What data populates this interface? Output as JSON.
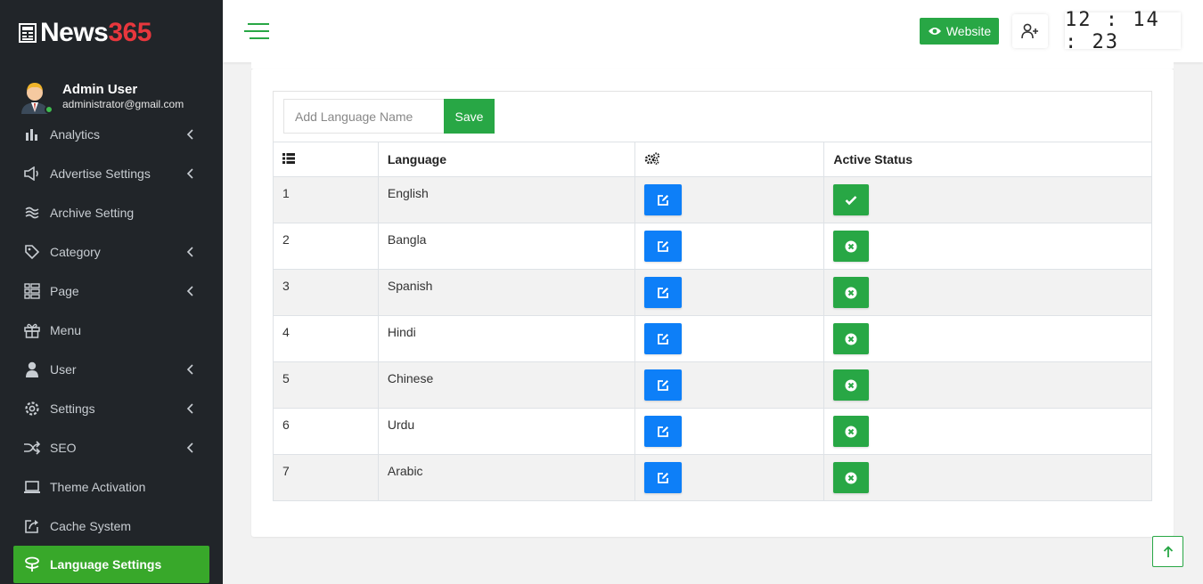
{
  "brand": {
    "name_part1": "News",
    "name_part2": "365"
  },
  "user": {
    "name": "Admin User",
    "email": "administrator@gmail.com"
  },
  "sidebar": {
    "items": [
      {
        "label": "Analytics",
        "icon": "bar-chart-icon",
        "has_submenu": true
      },
      {
        "label": "Advertise Settings",
        "icon": "megaphone-icon",
        "has_submenu": true
      },
      {
        "label": "Archive Setting",
        "icon": "archive-waves-icon",
        "has_submenu": false
      },
      {
        "label": "Category",
        "icon": "tag-icon",
        "has_submenu": true
      },
      {
        "label": "Page",
        "icon": "page-list-icon",
        "has_submenu": true
      },
      {
        "label": "Menu",
        "icon": "gift-icon",
        "has_submenu": false
      },
      {
        "label": "User",
        "icon": "user-icon",
        "has_submenu": true
      },
      {
        "label": "Settings",
        "icon": "gear-icon",
        "has_submenu": true
      },
      {
        "label": "SEO",
        "icon": "shuffle-icon",
        "has_submenu": true
      },
      {
        "label": "Theme Activation",
        "icon": "laptop-icon",
        "has_submenu": false
      },
      {
        "label": "Cache System",
        "icon": "share-square-icon",
        "has_submenu": false
      },
      {
        "label": "Language Settings",
        "icon": "language-icon",
        "has_submenu": false,
        "active": true
      }
    ]
  },
  "topbar": {
    "website_label": "Website",
    "clock": "12 : 14 : 23"
  },
  "form": {
    "placeholder": "Add Language Name",
    "save_label": "Save"
  },
  "table": {
    "headers": {
      "language": "Language",
      "status": "Active Status"
    },
    "rows": [
      {
        "id": "1",
        "language": "English",
        "active": true
      },
      {
        "id": "2",
        "language": "Bangla",
        "active": false
      },
      {
        "id": "3",
        "language": "Spanish",
        "active": false
      },
      {
        "id": "4",
        "language": "Hindi",
        "active": false
      },
      {
        "id": "5",
        "language": "Chinese",
        "active": false
      },
      {
        "id": "6",
        "language": "Urdu",
        "active": false
      },
      {
        "id": "7",
        "language": "Arabic",
        "active": false
      }
    ]
  },
  "colors": {
    "sidebar_bg": "#212529",
    "accent_green": "#28a745",
    "active_nav": "#38a82a",
    "edit_blue": "#0d7ff8",
    "brand_red": "#e8373d"
  }
}
